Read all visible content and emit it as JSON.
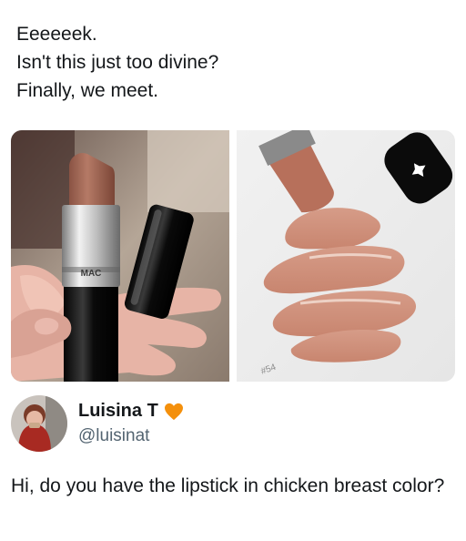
{
  "post": {
    "lines": [
      "Eeeeeek.",
      "Isn't this just too divine?",
      "Finally, we meet."
    ]
  },
  "media": {
    "left_photo": {
      "brand_text": "MAC"
    },
    "right_photo": {
      "shade_text": "#54"
    }
  },
  "reply": {
    "display_name": "Luisina T",
    "badge_icon": "orange-heart-icon",
    "badge_color": "#f4900c",
    "handle": "@luisinat",
    "text": "Hi, do you have the lipstick in chicken breast color?"
  }
}
